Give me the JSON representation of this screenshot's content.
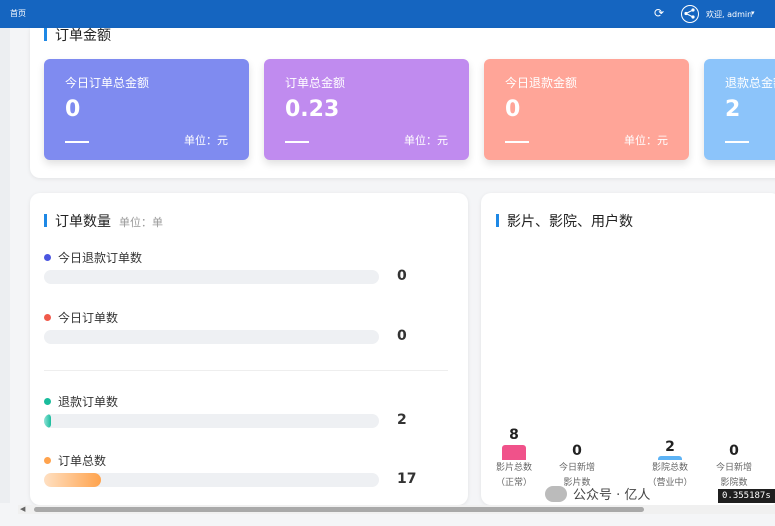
{
  "header": {
    "home": "首页",
    "welcome": "欢迎, admin",
    "caret": "▾",
    "refresh": "⟳"
  },
  "amount": {
    "title": "订单金额",
    "cards": [
      {
        "label": "今日订单总金额",
        "value": "0",
        "unit": "单位：元",
        "color": "#7f8bf0"
      },
      {
        "label": "订单总金额",
        "value": "0.23",
        "unit": "单位：元",
        "color": "#c08bef"
      },
      {
        "label": "今日退款金额",
        "value": "0",
        "unit": "单位：元",
        "color": "#ffa598"
      },
      {
        "label": "退款总金额",
        "value": "2",
        "unit": "",
        "color": "#8cc4fa"
      }
    ]
  },
  "orders": {
    "title": "订单数量",
    "unit": "单位：单",
    "items": [
      {
        "name": "今日退款订单数",
        "count": "0",
        "dot": "#4b56e0",
        "fill_fraction": 0
      },
      {
        "name": "今日订单数",
        "count": "0",
        "dot": "#f05a4b",
        "fill_fraction": 0
      },
      {
        "name": "退款订单数",
        "count": "2",
        "dot": "#1abc9c",
        "fill_fraction": 0.02
      },
      {
        "name": "订单总数",
        "count": "17",
        "dot": "#ffa34d",
        "fill_fraction": 0.17
      }
    ]
  },
  "stats": {
    "title": "影片、影院、用户数",
    "items": [
      {
        "value": "8",
        "label1": "影片总数",
        "label2": "（正常）",
        "color": "#f0528a"
      },
      {
        "value": "0",
        "label1": "今日新增",
        "label2": "影片数",
        "color": ""
      },
      {
        "value": "2",
        "label1": "影院总数",
        "label2": "（营业中）",
        "color": "#5db3f5"
      },
      {
        "value": "0",
        "label1": "今日新增",
        "label2": "影院数",
        "color": ""
      }
    ]
  },
  "watermark": "公众号 · 亿人",
  "overlay": "0.355187s"
}
